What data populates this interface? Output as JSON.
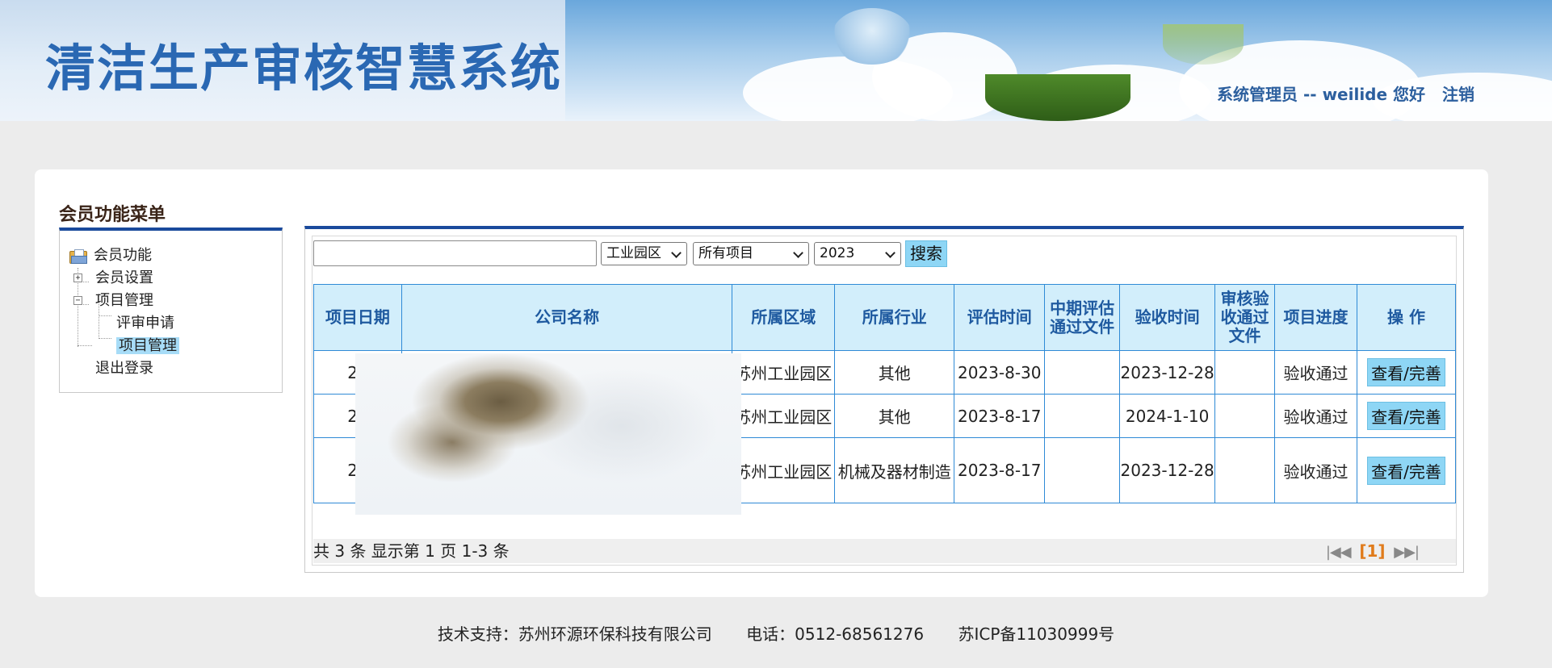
{
  "header": {
    "title": "清洁生产审核智慧系统",
    "greeting": "系统管理员 -- weilide 您好",
    "logout": "注销"
  },
  "sidebar": {
    "title": "会员功能菜单",
    "root": "会员功能",
    "items": [
      {
        "label": "会员设置"
      },
      {
        "label": "项目管理"
      },
      {
        "label": "评审申请"
      },
      {
        "label": "项目管理"
      },
      {
        "label": "退出登录"
      }
    ]
  },
  "search": {
    "keyword_value": "",
    "area_value": "工业园区",
    "project_value": "所有项目",
    "year_value": "2023",
    "button": "搜索"
  },
  "table": {
    "columns": [
      "项目日期",
      "公司名称",
      "所属区域",
      "所属行业",
      "评估时间",
      "中期评估通过文件",
      "验收时间",
      "审核验收通过文件",
      "项目进度",
      "操 作"
    ],
    "rows": [
      {
        "date": "20",
        "company": "",
        "area": "苏州工业园区",
        "industry": "其他",
        "eval": "2023-8-30",
        "mid_file": "",
        "accept": "2023-12-28",
        "accept_file": "",
        "progress": "验收通过",
        "op": "查看/完善"
      },
      {
        "date": "20",
        "company": "",
        "area": "苏州工业园区",
        "industry": "其他",
        "eval": "2023-8-17",
        "mid_file": "",
        "accept": "2024-1-10",
        "accept_file": "",
        "progress": "验收通过",
        "op": "查看/完善"
      },
      {
        "date": "20",
        "company": "",
        "area": "苏州工业园区",
        "industry": "机械及器材制造",
        "eval": "2023-8-17",
        "mid_file": "",
        "accept": "2023-12-28",
        "accept_file": "",
        "progress": "验收通过",
        "op": "查看/完善"
      }
    ]
  },
  "pagination": {
    "summary": "共 3 条 显示第 1 页 1-3 条",
    "first": "|◀◀",
    "current": "[1]",
    "last": "▶▶|"
  },
  "footer": {
    "support": "技术支持：苏州环源环保科技有限公司",
    "phone": "电话：0512-68561276",
    "icp": "苏ICP备11030999号"
  }
}
